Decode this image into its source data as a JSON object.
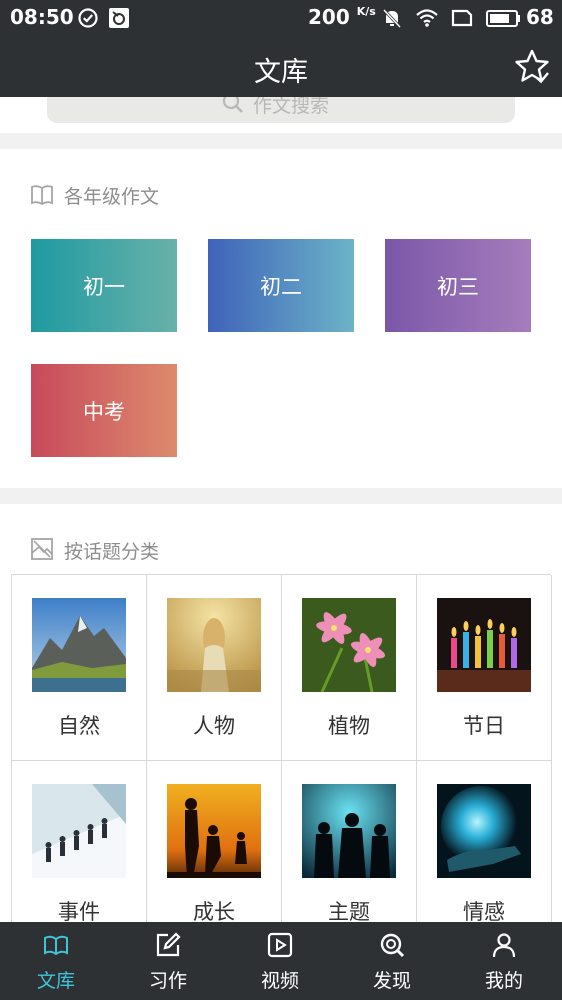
{
  "status_bar": {
    "time": "08:50",
    "net_speed": "200",
    "net_unit": "K/s",
    "battery": "68"
  },
  "header": {
    "title": "文库",
    "favorite_icon": "star-check-icon"
  },
  "search": {
    "placeholder": "作文搜索"
  },
  "grade_section": {
    "title": "各年级作文",
    "icon": "open-book-icon",
    "items": [
      {
        "label": "初一",
        "color_from": "#1f9aa1",
        "color_to": "#69b1a9"
      },
      {
        "label": "初二",
        "color_from": "#3f63b9",
        "color_to": "#6cb3c8"
      },
      {
        "label": "初三",
        "color_from": "#7b57a8",
        "color_to": "#a57dbc"
      },
      {
        "label": "中考",
        "color_from": "#c84a5c",
        "color_to": "#dc8a6c"
      }
    ]
  },
  "topic_section": {
    "title": "按话题分类",
    "icon": "picture-icon",
    "items": [
      {
        "label": "自然"
      },
      {
        "label": "人物"
      },
      {
        "label": "植物"
      },
      {
        "label": "节日"
      },
      {
        "label": "事件"
      },
      {
        "label": "成长"
      },
      {
        "label": "主题"
      },
      {
        "label": "情感"
      }
    ]
  },
  "tab_bar": {
    "active_color": "#3ec5d8",
    "tabs": [
      {
        "label": "文库",
        "icon": "book-icon",
        "active": true
      },
      {
        "label": "习作",
        "icon": "edit-icon",
        "active": false
      },
      {
        "label": "视频",
        "icon": "video-icon",
        "active": false
      },
      {
        "label": "发现",
        "icon": "discover-icon",
        "active": false
      },
      {
        "label": "我的",
        "icon": "person-icon",
        "active": false
      }
    ]
  }
}
